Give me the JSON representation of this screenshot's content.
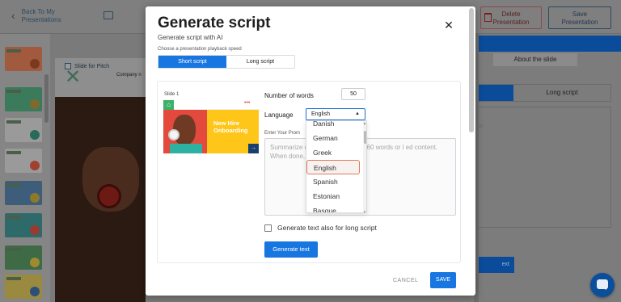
{
  "app": {
    "back_label_line1": "Back To My",
    "back_label_line2": "Presentations",
    "delete_label_line1": "Delete",
    "delete_label_line2": "Presentation",
    "save_label_line1": "Save",
    "save_label_line2": "Presentation",
    "slide_for_pitch": "Slide for Pitch",
    "company_fragment": "Company n",
    "right_panel": {
      "about_tab": "About the slide",
      "label_fragment": "d",
      "long_script_tab": "Long script",
      "area_fragment": "lide",
      "button_fragment": "ext"
    }
  },
  "modal": {
    "title": "Generate script",
    "subtitle": "Generate script with AI",
    "speed_label": "Choose a presentation playback speed",
    "speed_options": [
      "Short script",
      "Long script"
    ],
    "slide_label": "Slide 1",
    "preview_title": "New Hire Onboarding",
    "words_label": "Number of words",
    "words_value": "50",
    "language_label": "Language",
    "language_value": "English",
    "prompt_label": "Enter Your Prom",
    "prompt_placeholder": "Summarize or formulate a task in 60 words or l ed content. When done, don't forg w",
    "language_options": [
      "Danish",
      "German",
      "Greek",
      "English",
      "Spanish",
      "Estonian",
      "Basque"
    ],
    "long_script_checkbox": "Generate text also for long script",
    "generate_button": "Generate text",
    "cancel_button": "CANCEL",
    "save_button": "SAVE"
  },
  "colors": {
    "accent": "#1776e0",
    "overlay": "#7a7a7a",
    "selected_border": "#e07a5a",
    "preview_yellow": "#ffc61a",
    "preview_red": "#e3493c"
  }
}
